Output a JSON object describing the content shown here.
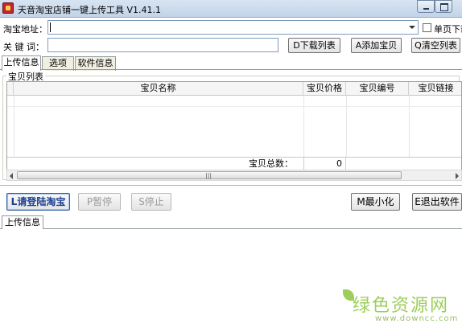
{
  "window": {
    "title": "天音淘宝店铺一键上传工具 V1.41.1"
  },
  "form": {
    "url_label": "淘宝地址：",
    "url_value": "",
    "single_page_label": "单页下载",
    "keyword_label": "关 键 词：",
    "keyword_value": "",
    "download_list_button": "D下载列表",
    "add_item_button": "A添加宝贝",
    "clear_list_button": "Q清空列表"
  },
  "tabs": [
    {
      "label": "上传信息",
      "active": true
    },
    {
      "label": "选项",
      "active": false
    },
    {
      "label": "软件信息",
      "active": false
    }
  ],
  "item_list": {
    "group_title": "宝贝列表",
    "columns": [
      "宝贝名称",
      "宝贝价格",
      "宝贝编号",
      "宝贝链接"
    ],
    "rows": [],
    "total_label": "宝贝总数：",
    "total_value": "0"
  },
  "scrollbar": {
    "grip": "|||"
  },
  "actions": {
    "login_button": "L请登陆淘宝",
    "pause_button": "P暂停",
    "stop_button": "S停止",
    "minimize_button": "M最小化",
    "exit_button": "E退出软件"
  },
  "log": {
    "tab_label": "上传信息",
    "content": ""
  },
  "watermark": {
    "logo_text": "绿色资源网",
    "url_text": "www.downcc.com",
    "color": "#8cc63f"
  },
  "colors": {
    "titlebar": "#c3d4e8",
    "primary_button_text": "#1a3d8f",
    "disabled_text": "#9a9a9a"
  }
}
